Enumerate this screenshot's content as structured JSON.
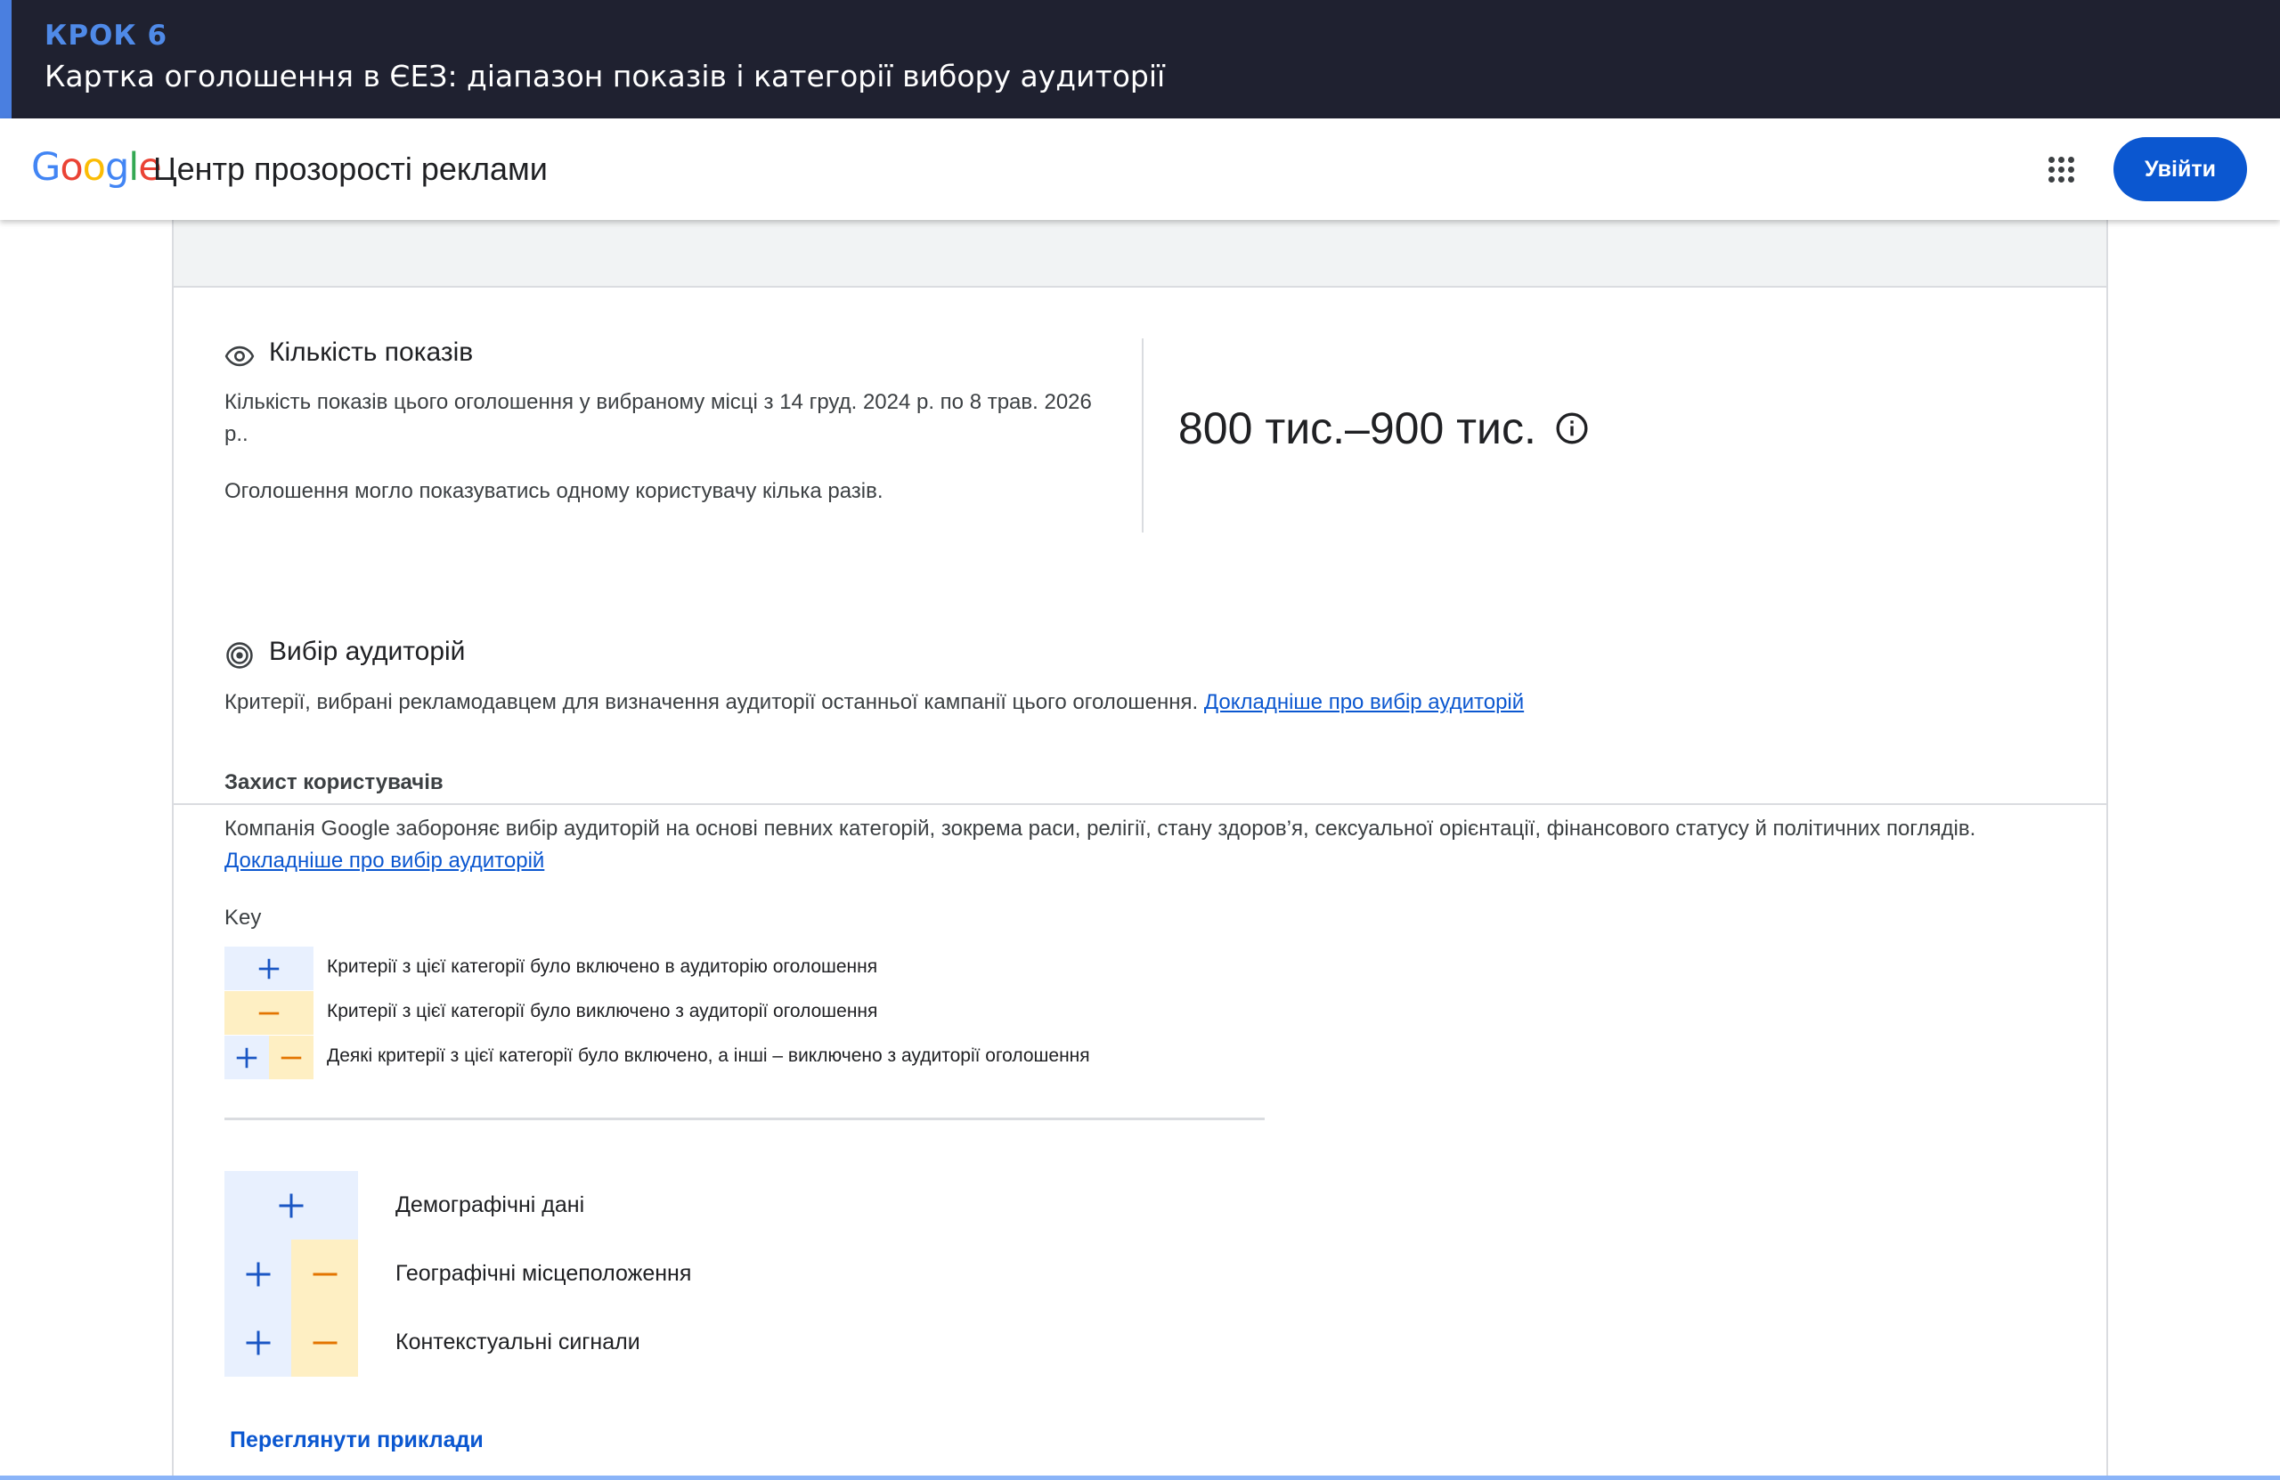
{
  "banner": {
    "step": "КРОК 6",
    "caption": "Картка оголошення в ЄЕЗ: діапазон показів і категорії вибору аудиторії"
  },
  "header": {
    "logo_letters": [
      "G",
      "o",
      "o",
      "g",
      "l",
      "e"
    ],
    "title": "Центр прозорості реклами",
    "signin_label": "Увійти"
  },
  "impressions": {
    "title": "Кількість показів",
    "description": "Кількість показів цього оголошення у вибраному місці з 14 груд. 2024 р. по 8 трав. 2026 р..",
    "note": "Оголошення могло показуватись одному користувачу кілька разів.",
    "value": "800 тис.–900 тис."
  },
  "audience": {
    "title": "Вибір аудиторій",
    "description": "Критерії, вибрані рекламодавцем для визначення аудиторії останньої кампанії цього оголошення.",
    "learn_more": "Докладніше про вибір аудиторій",
    "protection_title": "Захист користувачів",
    "protection_text": "Компанія Google забороняє вибір аудиторій на основі певних категорій, зокрема раси, релігії, стану здоров’я, сексуальної орієнтації, фінансового статусу й політичних поглядів.",
    "protection_link": "Докладніше про вибір аудиторій",
    "key_label": "Key",
    "key": [
      {
        "type": "include",
        "text": "Критерії з цієї категорії було включено в аудиторію оголошення"
      },
      {
        "type": "exclude",
        "text": "Критерії з цієї категорії було виключено з аудиторії оголошення"
      },
      {
        "type": "mixed",
        "text": "Деякі критерії з цієї категорії було включено, а інші – виключено з аудиторії оголошення"
      }
    ],
    "categories": [
      {
        "type": "include",
        "name": "Демографічні дані"
      },
      {
        "type": "mixed",
        "name": "Географічні місцеположення"
      },
      {
        "type": "mixed",
        "name": "Контекстуальні сигнали"
      }
    ],
    "examples_label": "Переглянути приклади"
  },
  "colors": {
    "include_bg": "#e8f0fe",
    "include_fg": "#1a56c4",
    "exclude_bg": "#feefc3",
    "exclude_fg": "#e37400",
    "link": "#0b57d0"
  }
}
